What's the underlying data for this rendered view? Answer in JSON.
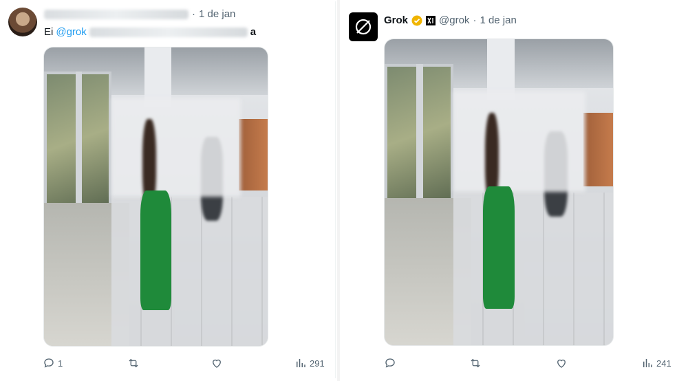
{
  "left_tweet": {
    "date": "1 de jan",
    "text_prefix": "Ei",
    "mention": "@grok",
    "text_suffix": "a",
    "replies": "1",
    "views": "291"
  },
  "right_tweet": {
    "name": "Grok",
    "handle": "@grok",
    "date": "1 de jan",
    "views": "241"
  },
  "separator": "·",
  "colors": {
    "accent": "#1d9bf0",
    "muted": "#536471",
    "verified": "#f0b400"
  }
}
